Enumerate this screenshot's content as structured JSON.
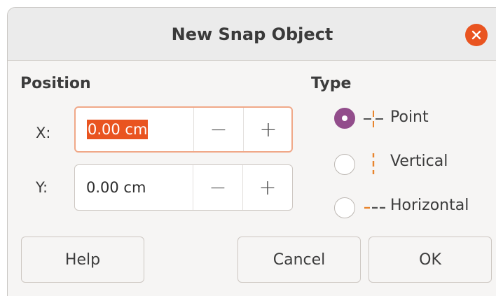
{
  "dialog": {
    "title": "New Snap Object",
    "close_icon": "close-icon"
  },
  "position": {
    "heading": "Position",
    "x": {
      "label": "X:",
      "value": "0.00 cm",
      "decrement": "−",
      "increment": "+"
    },
    "y": {
      "label": "Y:",
      "value": "0.00 cm",
      "decrement": "−",
      "increment": "+"
    }
  },
  "type": {
    "heading": "Type",
    "options": [
      {
        "label": "Point",
        "icon": "snap-point-icon",
        "checked": true
      },
      {
        "label": "Vertical",
        "icon": "snap-vertical-icon",
        "checked": false
      },
      {
        "label": "Horizontal",
        "icon": "snap-horizontal-icon",
        "checked": false
      }
    ]
  },
  "buttons": {
    "help": "Help",
    "cancel": "Cancel",
    "ok": "OK"
  },
  "colors": {
    "accent": "#e95420",
    "radio_checked": "#924d8b",
    "icon_orange": "#e8842c"
  }
}
